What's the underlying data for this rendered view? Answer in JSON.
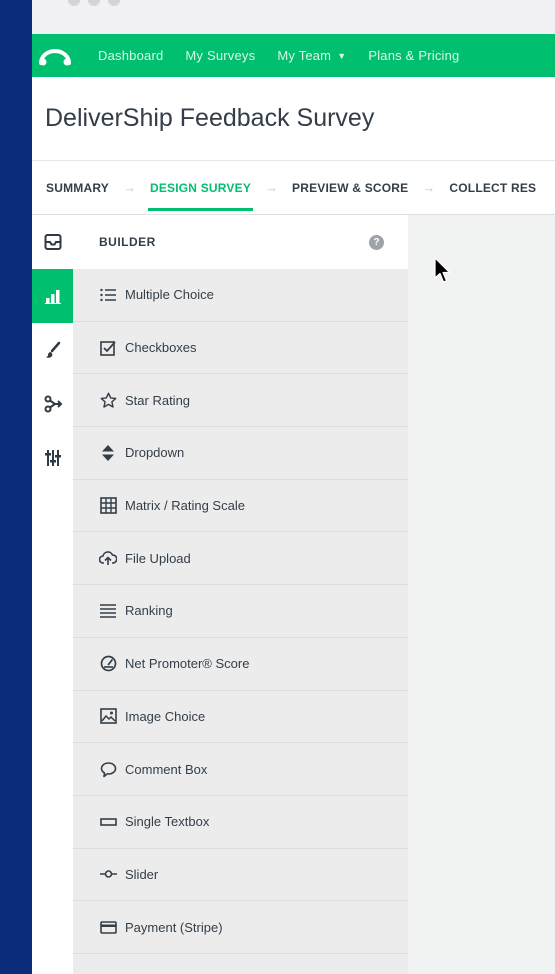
{
  "topnav": {
    "items": [
      {
        "label": "Dashboard"
      },
      {
        "label": "My Surveys"
      },
      {
        "label": "My Team"
      },
      {
        "label": "Plans & Pricing"
      }
    ]
  },
  "survey": {
    "title": "DeliverShip Feedback Survey"
  },
  "steps": [
    {
      "label": "SUMMARY"
    },
    {
      "label": "DESIGN SURVEY"
    },
    {
      "label": "PREVIEW & SCORE"
    },
    {
      "label": "COLLECT RES"
    }
  ],
  "builder": {
    "title": "BUILDER",
    "help": "?",
    "items": [
      {
        "label": "Multiple Choice"
      },
      {
        "label": "Checkboxes"
      },
      {
        "label": "Star Rating"
      },
      {
        "label": "Dropdown"
      },
      {
        "label": "Matrix / Rating Scale"
      },
      {
        "label": "File Upload"
      },
      {
        "label": "Ranking"
      },
      {
        "label": "Net Promoter® Score"
      },
      {
        "label": "Image Choice"
      },
      {
        "label": "Comment Box"
      },
      {
        "label": "Single Textbox"
      },
      {
        "label": "Slider"
      },
      {
        "label": "Payment (Stripe)"
      }
    ]
  },
  "colors": {
    "brand": "#00bf6f",
    "side": "#0b2c7a",
    "text": "#333e48"
  }
}
